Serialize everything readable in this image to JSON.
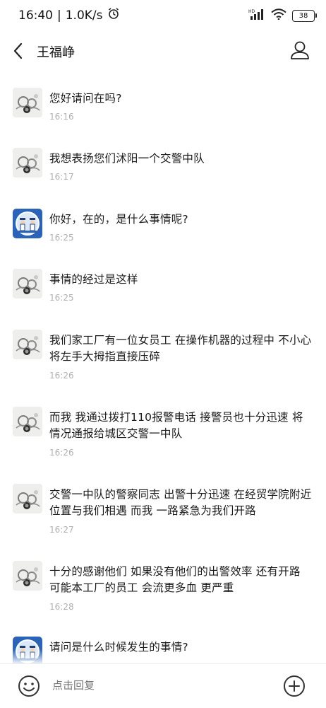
{
  "status_bar": {
    "time": "16:40",
    "speed": "1.0K/s",
    "network": "HD",
    "battery": "38"
  },
  "header": {
    "title": "王福峥"
  },
  "messages": [
    {
      "sender": "user",
      "text": "您好请问在吗?",
      "time": "16:16"
    },
    {
      "sender": "user",
      "text": "我想表扬您们沭阳一个交警中队",
      "time": "16:17"
    },
    {
      "sender": "police",
      "text": "你好，在的，是什么事情呢?",
      "time": "16:25"
    },
    {
      "sender": "user",
      "text": "事情的经过是这样",
      "time": "16:25"
    },
    {
      "sender": "user",
      "text": "我们家工厂有一位女员工 在操作机器的过程中 不小心将左手大拇指直接压碎",
      "time": "16:26"
    },
    {
      "sender": "user",
      "text": "而我 我通过拨打110报警电话 接警员也十分迅速 将情况通报给城区交警一中队",
      "time": "16:26"
    },
    {
      "sender": "user",
      "text": "交警一中队的警察同志 出警十分迅速 在经贸学院附近位置与我们相遇 而我 一路紧急为我们开路",
      "time": "16:27"
    },
    {
      "sender": "user",
      "text": "十分的感谢他们 如果没有他们的出警效率 还有开路 可能本工厂的员工 会流更多血 更严重",
      "time": "16:28"
    },
    {
      "sender": "police",
      "text": "请问是什么时候发生的事情?",
      "time": ""
    }
  ],
  "input": {
    "placeholder": "点击回复"
  },
  "icons": {
    "back": "chevron-left-icon",
    "profile": "person-icon",
    "emoji": "smiley-icon",
    "add": "plus-circle-icon",
    "signal": "signal-icon",
    "wifi": "wifi-icon",
    "alarm": "alarm-icon"
  },
  "colors": {
    "police_avatar_bg": "#2a63b8",
    "time_text": "#b0b0b0",
    "placeholder": "#a9a9a9"
  }
}
